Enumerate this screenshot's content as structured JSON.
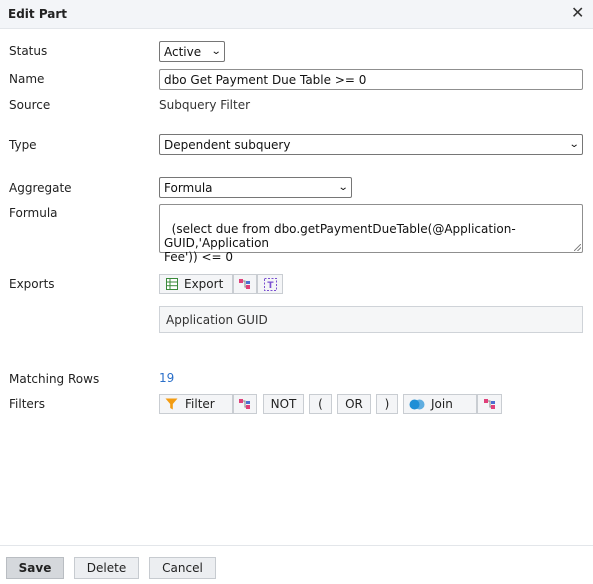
{
  "dialog": {
    "title": "Edit Part",
    "close_glyph": "✕"
  },
  "fields": {
    "status": {
      "label": "Status",
      "value": "Active"
    },
    "name": {
      "label": "Name",
      "value": "dbo Get Payment Due Table >= 0"
    },
    "source": {
      "label": "Source",
      "value": "Subquery Filter"
    },
    "type": {
      "label": "Type",
      "value": "Dependent subquery"
    },
    "aggregate": {
      "label": "Aggregate",
      "value": "Formula"
    },
    "formula": {
      "label": "Formula",
      "value": "(select due from dbo.getPaymentDueTable(@Application-GUID,'Application\nFee')) <= 0"
    },
    "exports": {
      "label": "Exports",
      "export_label": "Export",
      "item": "Application GUID"
    },
    "matching_rows": {
      "label": "Matching Rows",
      "value": "19"
    },
    "filters": {
      "label": "Filters",
      "filter_label": "Filter",
      "not_label": "NOT",
      "open_paren": "(",
      "or_label": "OR",
      "close_paren": ")",
      "join_label": "Join"
    }
  },
  "footer": {
    "save": "Save",
    "delete": "Delete",
    "cancel": "Cancel"
  },
  "icons": {
    "export": "table-export-icon",
    "tree": "tree-icon",
    "text": "text-field-icon",
    "filter": "funnel-icon",
    "join": "join-circles-icon"
  },
  "colors": {
    "link": "#2a6fc9",
    "funnel": "#f39c12",
    "join": "#1f8fd6",
    "tree": "#e0407a"
  }
}
